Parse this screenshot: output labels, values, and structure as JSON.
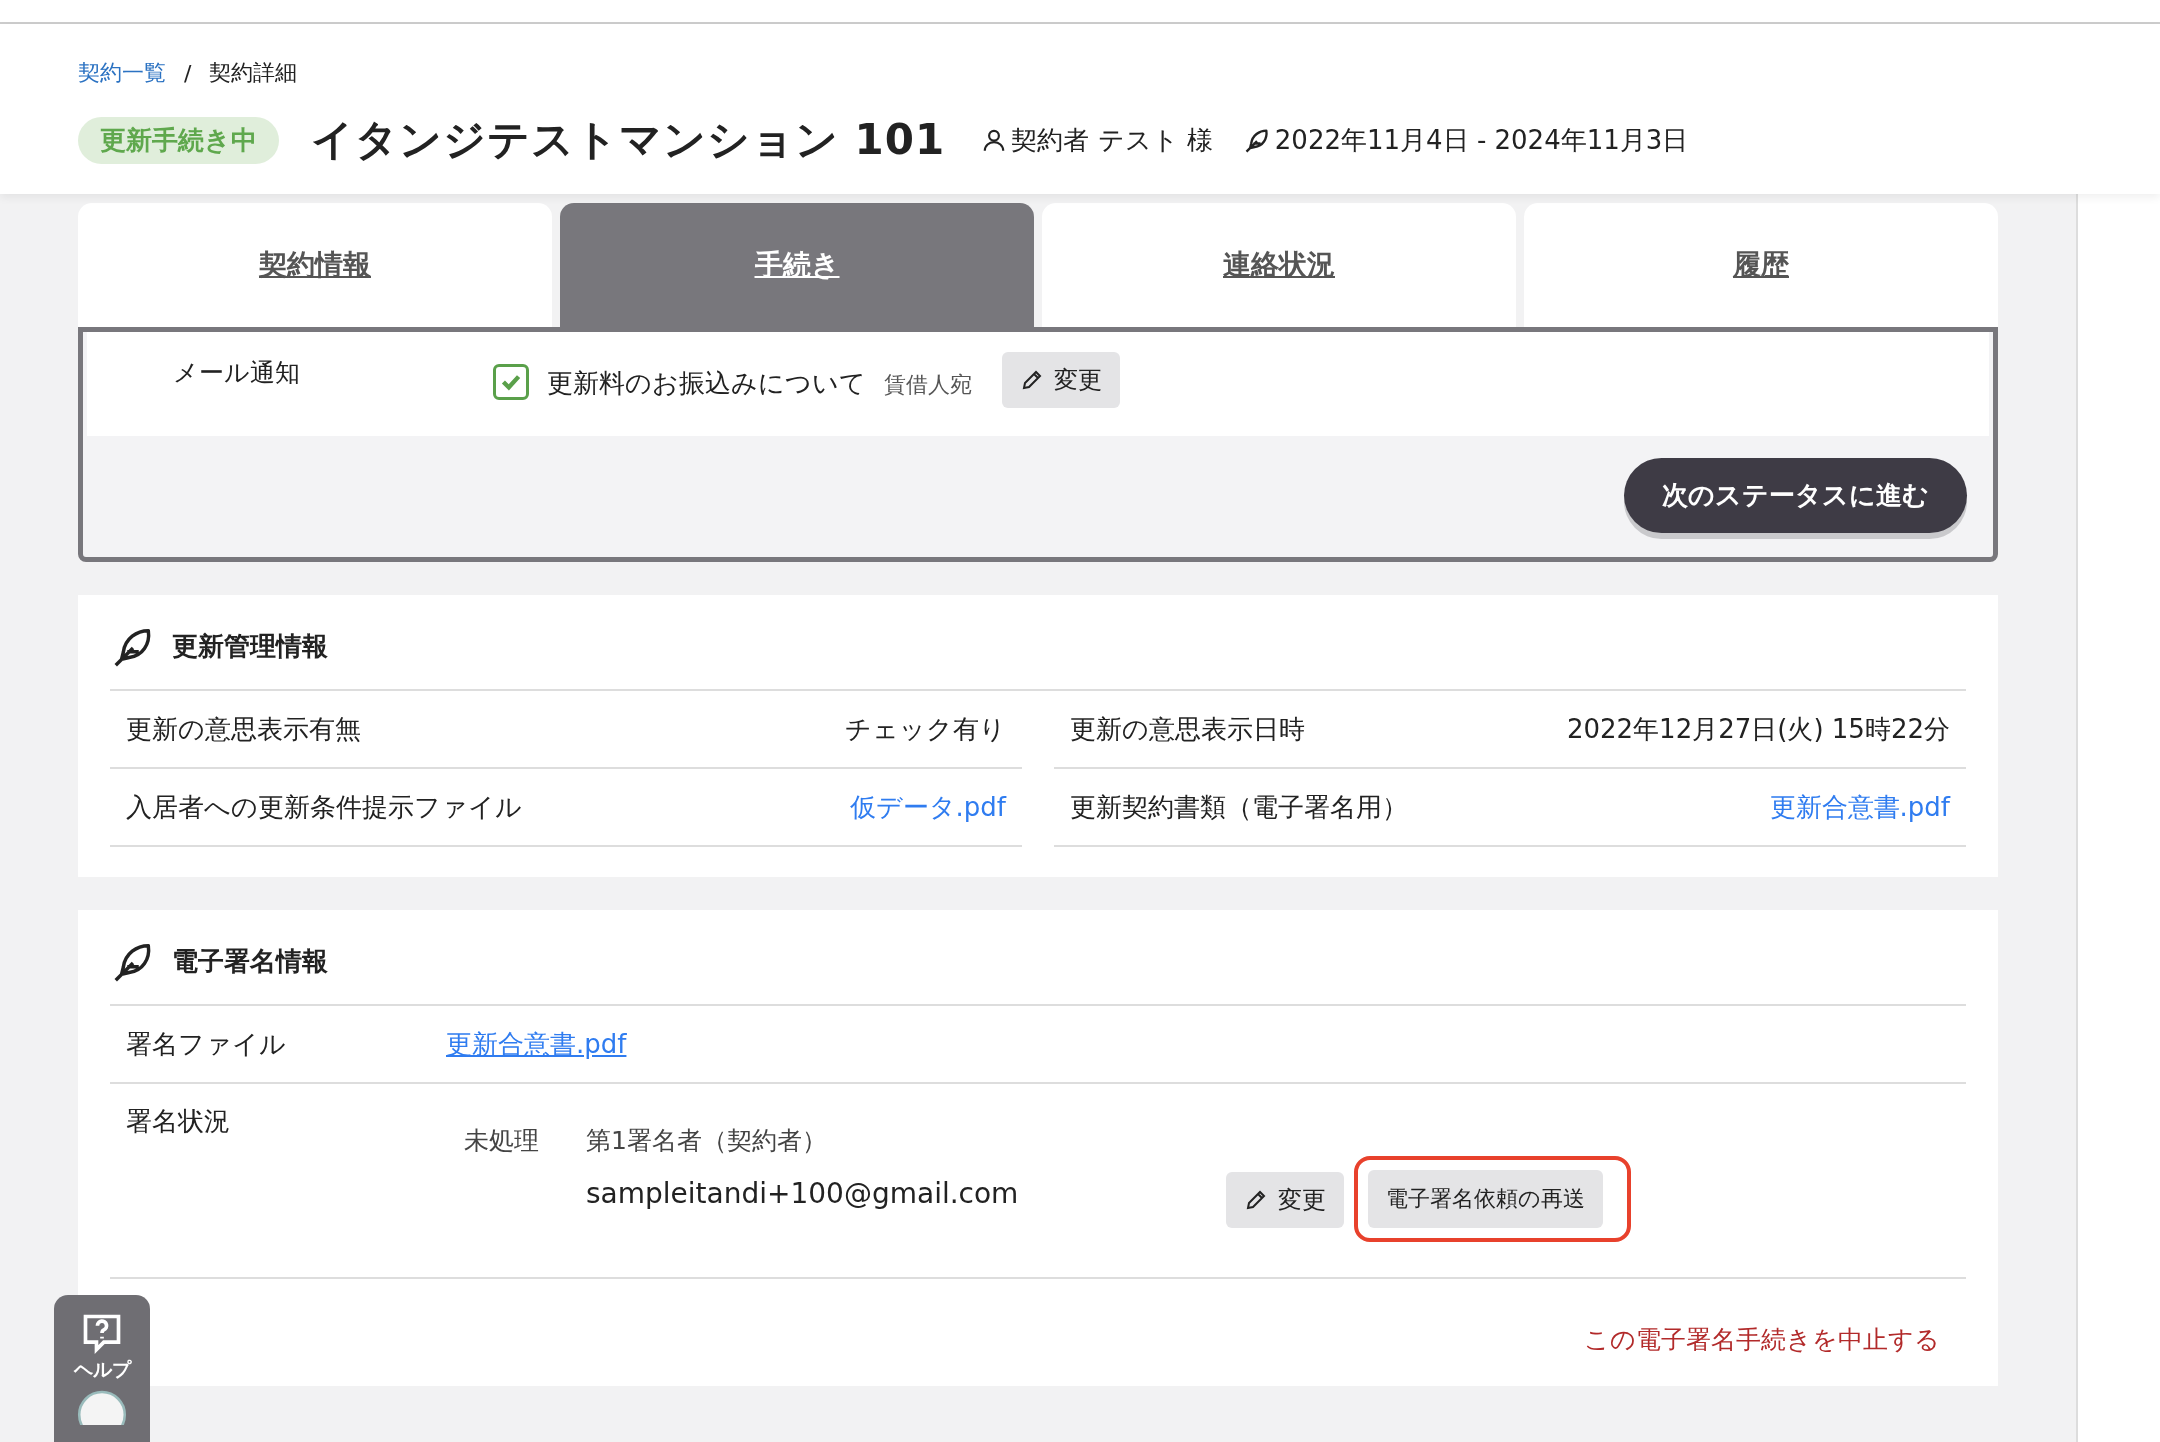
{
  "breadcrumb": [
    {
      "label": "契約一覧",
      "link": true
    },
    {
      "label": "契約詳細",
      "link": false
    }
  ],
  "breadcrumb_separator": "/",
  "header": {
    "status_badge": "更新手続き中",
    "title": "イタンジテストマンション 101",
    "contractor": "契約者 テスト 様",
    "period": "2022年11月4日 - 2024年11月3日"
  },
  "tabs": [
    {
      "label": "契約情報",
      "selected": false
    },
    {
      "label": "手続き",
      "selected": true
    },
    {
      "label": "連絡状況",
      "selected": false
    },
    {
      "label": "履歴",
      "selected": false
    }
  ],
  "mail_notification": {
    "label": "メール通知",
    "item": "更新料のお振込みについて",
    "checked": true,
    "recipient": "賃借人宛",
    "edit_button": "変更"
  },
  "next_status_button": "次のステータスに進む",
  "renewal_info": {
    "title": "更新管理情報",
    "rows": [
      {
        "label": "更新の意思表示有無",
        "value": "チェック有り",
        "link": false
      },
      {
        "label": "更新の意思表示日時",
        "value": "2022年12月27日(火) 15時22分",
        "link": false
      },
      {
        "label": "入居者への更新条件提示ファイル",
        "value": "仮データ.pdf",
        "link": true
      },
      {
        "label": "更新契約書類（電子署名用）",
        "value": "更新合意書.pdf",
        "link": true
      }
    ]
  },
  "esign_info": {
    "title": "電子署名情報",
    "file_label": "署名ファイル",
    "file": "更新合意書.pdf",
    "status_label": "署名状況",
    "signers": [
      {
        "status": "未処理",
        "role": "第1署名者（契約者）",
        "email": "sampleitandi+100@gmail.com",
        "edit_button": "変更",
        "resend_button": "電子署名依頼の再送",
        "highlighted": true
      }
    ],
    "cancel_link": "この電子署名手続きを中止する"
  },
  "help": {
    "label": "ヘルプ"
  }
}
